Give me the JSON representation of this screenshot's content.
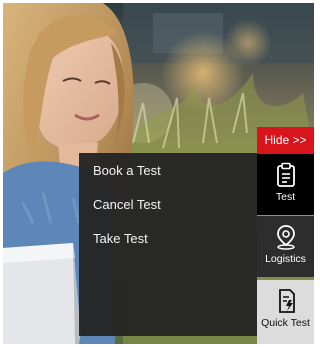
{
  "hide_button": {
    "label": "Hide >>"
  },
  "menu": {
    "items": [
      {
        "label": "Book a Test"
      },
      {
        "label": "Cancel Test"
      },
      {
        "label": "Take Test"
      }
    ]
  },
  "side_tabs": [
    {
      "label": "Test",
      "icon": "clipboard-icon"
    },
    {
      "label": "Logistics",
      "icon": "location-pin-icon"
    },
    {
      "label": "Quick Test",
      "icon": "quick-test-icon"
    }
  ],
  "colors": {
    "accent_red": "#d8151c",
    "panel_dark": "#242424",
    "active_tab": "#000000",
    "tab_dark": "#2d2d2d",
    "tab_light": "#dcdcdc"
  }
}
